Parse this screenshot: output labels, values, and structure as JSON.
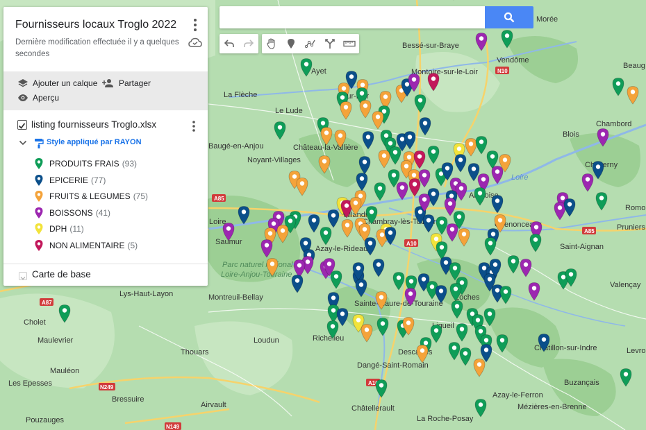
{
  "panel": {
    "title": "Fournisseurs locaux Troglo 2022",
    "subtitle": "Dernière modification effectuée il y a quelques secondes",
    "actions": {
      "add_layer": "Ajouter un calque",
      "share": "Partager",
      "preview": "Aperçu"
    },
    "layer": {
      "name": "listing fournisseurs Troglo.xlsx",
      "style": "Style appliqué par RAYON",
      "legend": [
        {
          "label": "PRODUITS FRAIS",
          "count": "(93)",
          "color": "#0f9d58"
        },
        {
          "label": "EPICERIE",
          "count": "(77)",
          "color": "#0b4f8a"
        },
        {
          "label": "FRUITS & LEGUMES",
          "count": "(75)",
          "color": "#f4a33a"
        },
        {
          "label": "BOISSONS",
          "count": "(41)",
          "color": "#9c27b0"
        },
        {
          "label": "DPH",
          "count": "(11)",
          "color": "#f2e33b"
        },
        {
          "label": "NON ALIMENTAIRE",
          "count": "(5)",
          "color": "#c2185b"
        }
      ]
    },
    "base_map": "Carte de base"
  },
  "search": {
    "placeholder": ""
  },
  "toolbar": [
    "undo-icon",
    "redo-icon",
    "hand-icon",
    "marker-icon",
    "draw-line-icon",
    "directions-icon",
    "ruler-icon"
  ],
  "map": {
    "places": [
      "Morée",
      "Bessé-sur-Braye",
      "Vendôme",
      "Montoire-sur-le-Loir",
      "Beaug",
      "La Flèche",
      "Le Lude",
      "Château-la-Vallière",
      "Chambord",
      "Blois",
      "Baugé-en-Anjou",
      "Noyant-Villages",
      "Cheverny",
      "Loire",
      "Amboise",
      "Tours",
      "Chambray-lès-Tours",
      "Romo",
      "Saumur",
      "Azay-le-Rideau",
      "Chenonceaux",
      "Pruniers",
      "Saint-Aignan",
      "Parc naturel régional Loire-Anjou-Touraine",
      "Loches",
      "Valençay",
      "Lys-Haut-Layon",
      "Montreuil-Bellay",
      "Sainte-Maure-de-Touraine",
      "Cholet",
      "Maulevrier",
      "Ligueil",
      "Loudun",
      "Richelieu",
      "Châtillon-sur-Indre",
      "Levroux",
      "Thouars",
      "Mauléon",
      "Dangé-Saint-Romain",
      "Descartes",
      "Les Epesses",
      "Bressuire",
      "Buzançais",
      "Azay-le-Ferron",
      "Airvault",
      "Châtellerault",
      "Mézières-en-Brenne",
      "Pouzauges",
      "La Roche-Posay",
      "Ayet",
      "Sur-Loir",
      "Villandry",
      "Loire"
    ],
    "roads": [
      "N10",
      "A85",
      "A85",
      "A10",
      "A87",
      "N249",
      "A10",
      "N149",
      "N10"
    ]
  }
}
